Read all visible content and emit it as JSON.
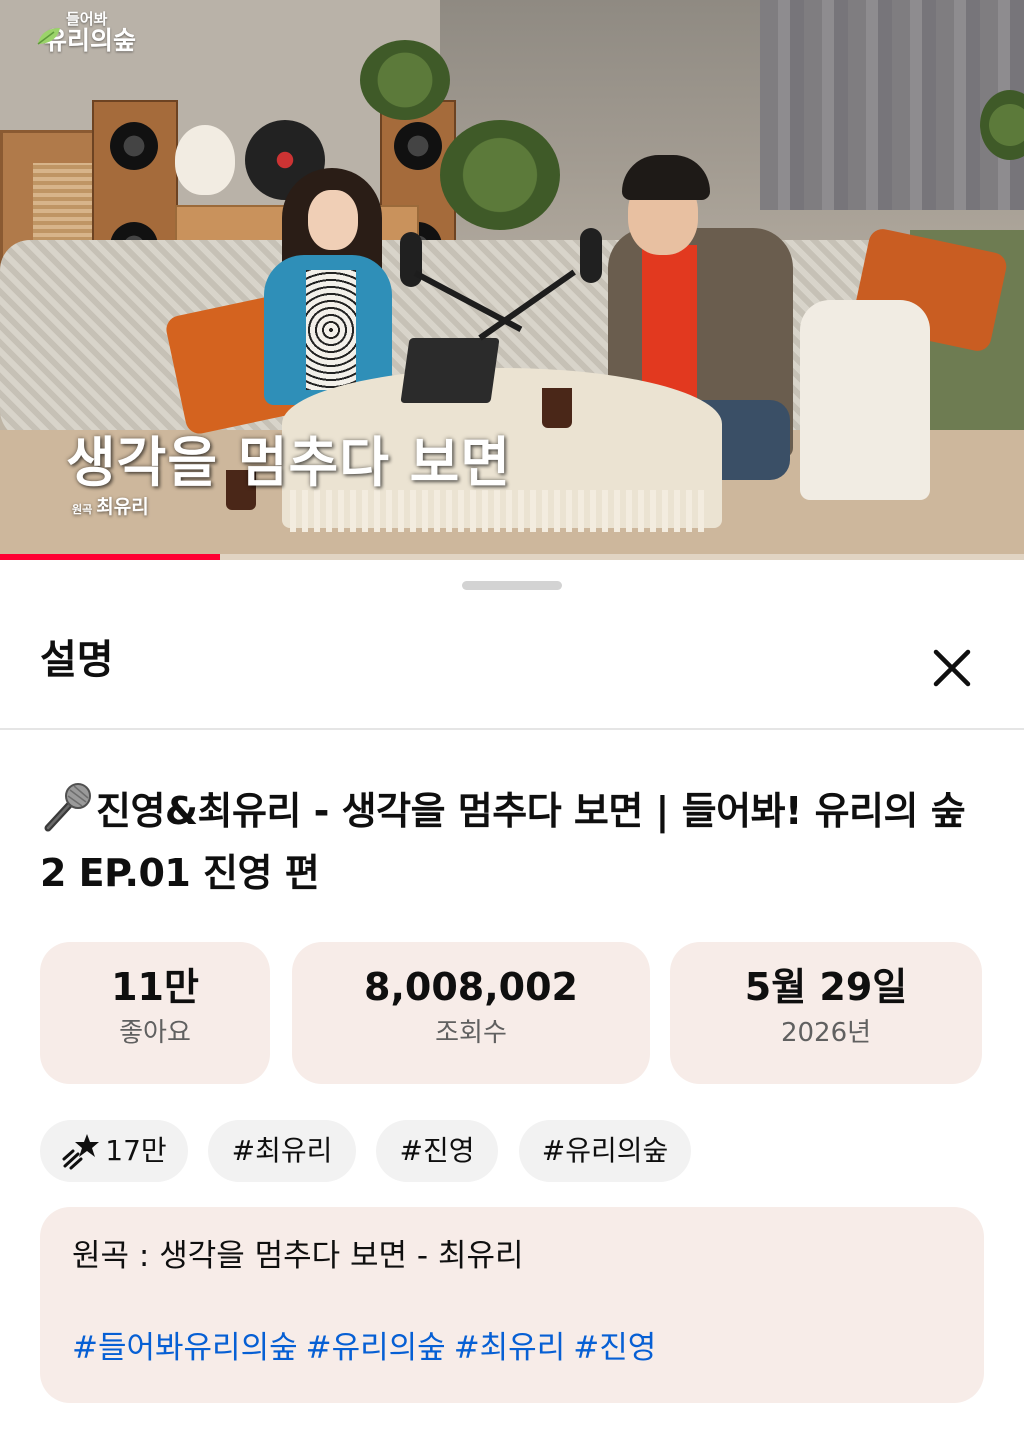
{
  "video": {
    "logo_line1": "들어봐",
    "logo_line2": "유리의숲",
    "caption": "생각을 멈추다 보면",
    "original_tag": "원곡",
    "original_artist": "최유리",
    "progress": 0.215,
    "progress_color": "#ff0033"
  },
  "sheet": {
    "title": "설명",
    "close_icon": "close-icon",
    "video_title_icon": "microphone-icon",
    "video_title": "진영&최유리 - 생각을 멈추다 보면 | 들어봐! 유리의 숲2 EP.01 진영 편",
    "stats": [
      {
        "value": "11만",
        "label": "좋아요"
      },
      {
        "value": "8,008,002",
        "label": "조회수"
      },
      {
        "value": "5월 29일",
        "label": "2026년"
      }
    ],
    "chips": {
      "shooting_star_icon": "shooting-star-icon",
      "supers_count": "17만",
      "hashtags": [
        "#최유리",
        "#진영",
        "#유리의숲"
      ]
    },
    "description": {
      "line1": "원곡 : 생각을 멈추다 보면 - 최유리",
      "hashtags": [
        "#들어봐유리의숲",
        "#유리의숲",
        "#최유리",
        "#진영"
      ],
      "link_color": "#065fd4"
    },
    "card_color": "#f7ece8"
  }
}
